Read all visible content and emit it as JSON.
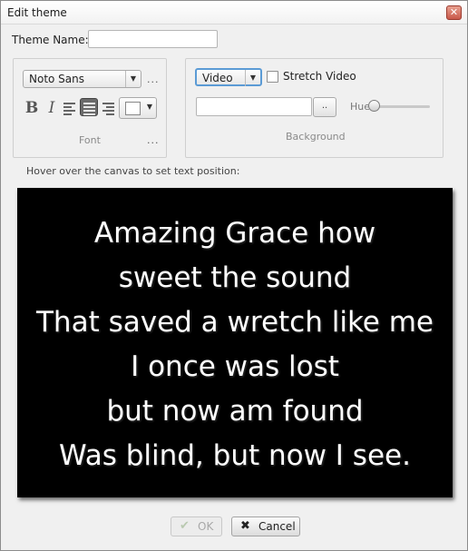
{
  "window": {
    "title": "Edit theme",
    "close_glyph": "✕"
  },
  "theme_name": {
    "label": "Theme Name:",
    "value": ""
  },
  "font_panel": {
    "font_family": "Noto Sans",
    "more_glyph": "...",
    "bold_glyph": "B",
    "italic_glyph": "I",
    "alignment_selected": "center",
    "text_color": "#ffffff",
    "caption": "Font",
    "caption_more": "..."
  },
  "background_panel": {
    "type": "Video",
    "stretch_label": "Stretch Video",
    "stretch_checked": false,
    "path_value": "",
    "browse_label": "..",
    "hue_label": "Hue",
    "hue_value": 0,
    "caption": "Background"
  },
  "hint": "Hover over the canvas to set text position:",
  "canvas": {
    "background": "#000000",
    "lines": [
      "Amazing Grace how",
      "sweet the sound",
      "That saved a wretch like me",
      "I once was lost",
      "but now am found",
      "Was blind, but now I see."
    ]
  },
  "buttons": {
    "ok_label": "OK",
    "ok_enabled": false,
    "cancel_label": "Cancel",
    "ok_icon": "✔",
    "cancel_icon": "✖"
  }
}
